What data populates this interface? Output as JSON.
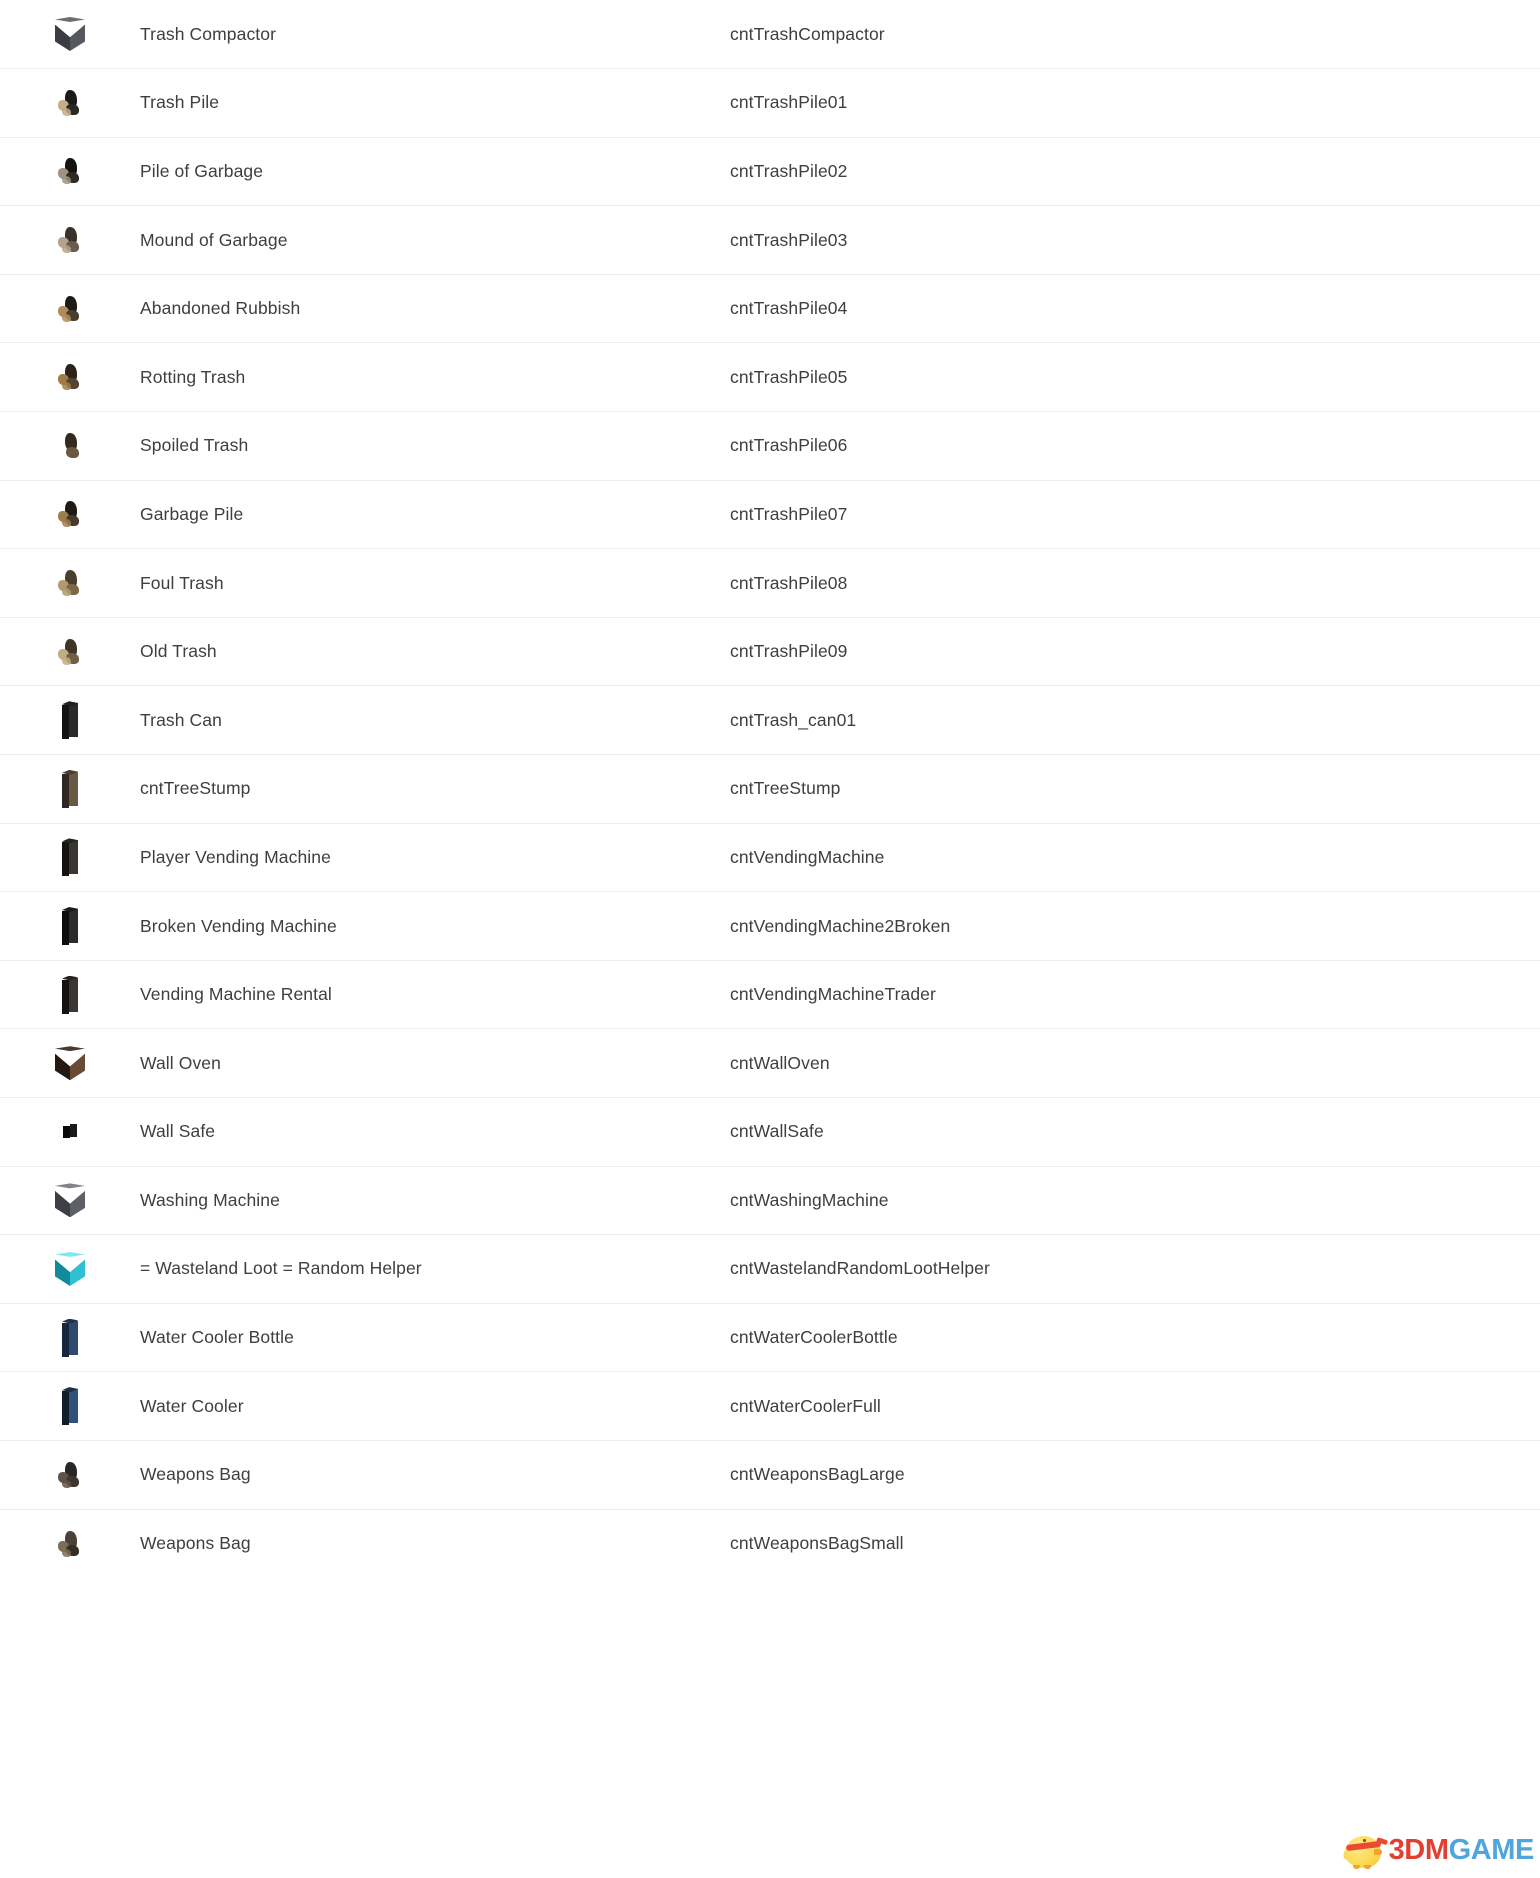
{
  "page": {
    "type": "reference-table",
    "columns": [
      "icon",
      "name",
      "id"
    ],
    "background_color": "#ffffff",
    "row_separator_color": "#ececec",
    "text_color": "#3c4043"
  },
  "rows": [
    {
      "name": "Trash Compactor",
      "id": "cntTrashCompactor",
      "icon": "trash-compactor-icon",
      "icon_style": "box",
      "colors": [
        "#6b6e73",
        "#3a3d42",
        "#55585d"
      ]
    },
    {
      "name": "Trash Pile",
      "id": "cntTrashPile01",
      "icon": "trash-pile-icon",
      "icon_style": "pile",
      "colors": [
        "#1c1b19",
        "#c6ad87",
        "#2a2724"
      ]
    },
    {
      "name": "Pile of Garbage",
      "id": "cntTrashPile02",
      "icon": "garbage-pile-icon",
      "icon_style": "pile",
      "colors": [
        "#15130f",
        "#9e9383",
        "#2e2a24"
      ]
    },
    {
      "name": "Mound of Garbage",
      "id": "cntTrashPile03",
      "icon": "garbage-mound-icon",
      "icon_style": "pile",
      "colors": [
        "#3a322a",
        "#b6a289",
        "#6a5c4c"
      ]
    },
    {
      "name": "Abandoned Rubbish",
      "id": "cntTrashPile04",
      "icon": "abandoned-rubbish-icon",
      "icon_style": "pile",
      "colors": [
        "#1e1a16",
        "#b08c5c",
        "#4a3d2e"
      ]
    },
    {
      "name": "Rotting Trash",
      "id": "cntTrashPile05",
      "icon": "rotting-trash-icon",
      "icon_style": "pile",
      "colors": [
        "#2b2218",
        "#a07c4a",
        "#574331"
      ]
    },
    {
      "name": "Spoiled Trash",
      "id": "cntTrashPile06",
      "icon": "spoiled-trash-icon",
      "icon_style": "pile",
      "colors": [
        "#342a1e",
        "#93apos",
        "#6c5740"
      ]
    },
    {
      "name": "Garbage Pile",
      "id": "cntTrashPile07",
      "icon": "garbage-pile-alt-icon",
      "icon_style": "pile",
      "colors": [
        "#201a14",
        "#9d7c4e",
        "#4a3a2a"
      ]
    },
    {
      "name": "Foul Trash",
      "id": "cntTrashPile08",
      "icon": "foul-trash-icon",
      "icon_style": "pile",
      "colors": [
        "#4a3f2e",
        "#b39a6e",
        "#7a6849"
      ]
    },
    {
      "name": "Old Trash",
      "id": "cntTrashPile09",
      "icon": "old-trash-icon",
      "icon_style": "pile",
      "colors": [
        "#3f3527",
        "#c2ab85",
        "#6f5f45"
      ]
    },
    {
      "name": "Trash Can",
      "id": "cntTrash_can01",
      "icon": "trash-can-icon",
      "icon_style": "tall",
      "colors": [
        "#2a2a2a",
        "#131313",
        "#1f1f1f"
      ]
    },
    {
      "name": "cntTreeStump",
      "id": "cntTreeStump",
      "icon": "tree-stump-icon",
      "icon_style": "tall",
      "colors": [
        "#6a5942",
        "#2f2822",
        "#4a3e30"
      ]
    },
    {
      "name": "Player Vending Machine",
      "id": "cntVendingMachine",
      "icon": "vending-machine-icon",
      "icon_style": "tall",
      "colors": [
        "#3a3733",
        "#141312",
        "#26241f"
      ]
    },
    {
      "name": "Broken Vending Machine",
      "id": "cntVendingMachine2Broken",
      "icon": "broken-vending-machine-icon",
      "icon_style": "tall",
      "colors": [
        "#2b2b2b",
        "#0d0d0d",
        "#1a1a1a"
      ]
    },
    {
      "name": "Vending Machine Rental",
      "id": "cntVendingMachineTrader",
      "icon": "vending-machine-rental-icon",
      "icon_style": "tall",
      "colors": [
        "#3a3733",
        "#141312",
        "#26241f"
      ]
    },
    {
      "name": "Wall Oven",
      "id": "cntWallOven",
      "icon": "wall-oven-icon",
      "icon_style": "box",
      "colors": [
        "#4c382c",
        "#241811",
        "#6a4a36"
      ]
    },
    {
      "name": "Wall Safe",
      "id": "cntWallSafe",
      "icon": "wall-safe-icon",
      "icon_style": "small",
      "colors": [
        "#1a1a1a",
        "#0a0a0a",
        "#101010"
      ]
    },
    {
      "name": "Washing Machine",
      "id": "cntWashingMachine",
      "icon": "washing-machine-icon",
      "icon_style": "box",
      "colors": [
        "#81858a",
        "#3c4046",
        "#5d6167"
      ]
    },
    {
      "name": "= Wasteland Loot = Random Helper",
      "id": "cntWastelandRandomLootHelper",
      "icon": "wasteland-loot-helper-icon",
      "icon_style": "box",
      "colors": [
        "#7fe8f2",
        "#128a9c",
        "#2fc0d4"
      ]
    },
    {
      "name": "Water Cooler Bottle",
      "id": "cntWaterCoolerBottle",
      "icon": "water-cooler-bottle-icon",
      "icon_style": "tall",
      "colors": [
        "#2e4a6e",
        "#16263c",
        "#20344f"
      ]
    },
    {
      "name": "Water Cooler",
      "id": "cntWaterCoolerFull",
      "icon": "water-cooler-icon",
      "icon_style": "tall",
      "colors": [
        "#30527a",
        "#121c2a",
        "#1d2f47"
      ]
    },
    {
      "name": "Weapons Bag",
      "id": "cntWeaponsBagLarge",
      "icon": "weapons-bag-large-icon",
      "icon_style": "pile",
      "colors": [
        "#2a2724",
        "#605246",
        "#3d372f"
      ]
    },
    {
      "name": "Weapons Bag",
      "id": "cntWeaponsBagSmall",
      "icon": "weapons-bag-small-icon",
      "icon_style": "pile",
      "colors": [
        "#4a4139",
        "#7d6c58",
        "#342d26"
      ]
    }
  ],
  "watermark": {
    "text_primary": "3DM",
    "text_secondary": "GAME",
    "color_primary": "#e0392b",
    "color_secondary": "#4aa3dd",
    "mascot": "chick-icon"
  }
}
